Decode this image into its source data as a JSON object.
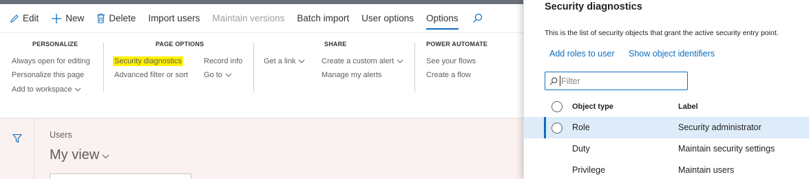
{
  "toolbar": {
    "items": [
      {
        "label": "Edit",
        "icon": "pencil-icon"
      },
      {
        "label": "New",
        "icon": "plus-icon"
      },
      {
        "label": "Delete",
        "icon": "trash-icon"
      },
      {
        "label": "Import users"
      },
      {
        "label": "Maintain versions",
        "disabled": true
      },
      {
        "label": "Batch import"
      },
      {
        "label": "User options"
      },
      {
        "label": "Options",
        "active": true
      }
    ],
    "search_icon": "search-icon"
  },
  "ribbon": {
    "personalize": {
      "title": "PERSONALIZE",
      "items": [
        "Always open for editing",
        "Personalize this page",
        "Add to workspace"
      ]
    },
    "page_options": {
      "title": "PAGE OPTIONS",
      "col1": [
        "Security diagnostics",
        "Advanced filter or sort"
      ],
      "col2": [
        "Record info",
        "Go to"
      ]
    },
    "share": {
      "title": "SHARE",
      "get_link": "Get a link",
      "items": [
        "Create a custom alert",
        "Manage my alerts"
      ]
    },
    "power_automate": {
      "title": "POWER AUTOMATE",
      "items": [
        "See your flows",
        "Create a flow"
      ]
    }
  },
  "content": {
    "breadcrumb": "Users",
    "view": "My view"
  },
  "panel": {
    "title": "Security diagnostics",
    "description": "This is the list of security objects that grant the active security entry point.",
    "links": [
      "Add roles to user",
      "Show object identifiers"
    ],
    "filter_placeholder": "Filter",
    "columns": [
      "Object type",
      "Label"
    ],
    "rows": [
      {
        "type": "Role",
        "label": "Security administrator",
        "selected": true
      },
      {
        "type": "Duty",
        "label": "Maintain security settings"
      },
      {
        "type": "Privilege",
        "label": "Maintain users"
      }
    ]
  },
  "colors": {
    "accent": "#0f6cbd",
    "highlight": "#fff100",
    "selected_row": "#deecf9",
    "content_bg": "#faf1f1"
  }
}
